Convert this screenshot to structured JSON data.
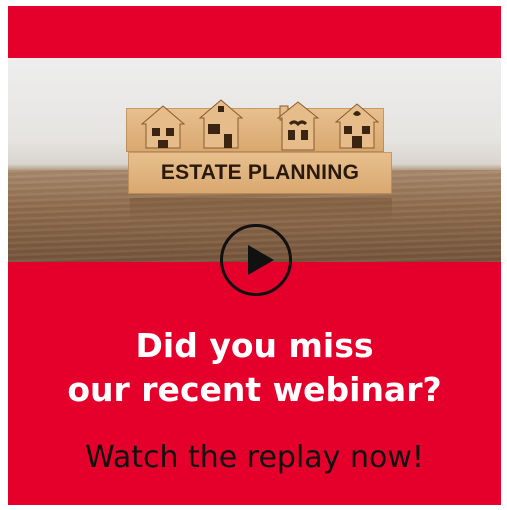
{
  "colors": {
    "brand_red": "#e4002b",
    "text_white": "#ffffff",
    "text_dark": "#111111"
  },
  "photo": {
    "sign_text": "ESTATE PLANNING",
    "icons": [
      "house-icon",
      "house-icon",
      "house-icon",
      "house-icon"
    ]
  },
  "play_button": {
    "icon": "play-icon"
  },
  "headline": {
    "line1": "Did you miss",
    "line2": "our recent webinar?"
  },
  "cta": {
    "text": "Watch the replay now!"
  }
}
